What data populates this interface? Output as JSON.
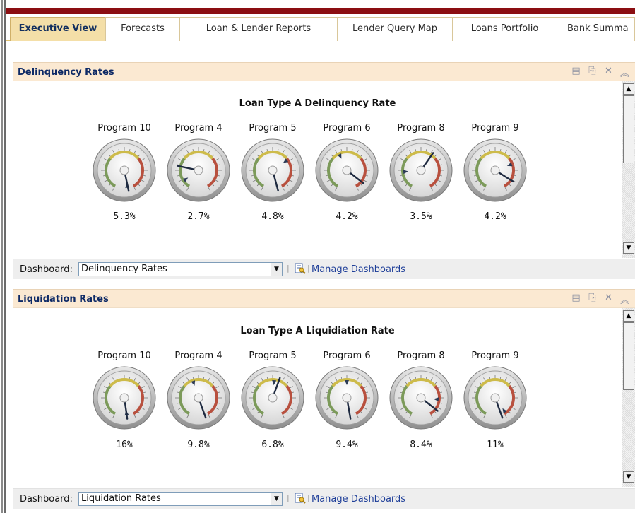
{
  "tabs": [
    {
      "label": "Executive View",
      "active": true
    },
    {
      "label": "Forecasts",
      "active": false
    },
    {
      "label": "Loan & Lender Reports",
      "active": false
    },
    {
      "label": "Lender Query Map",
      "active": false
    },
    {
      "label": "Loans Portfolio",
      "active": false
    },
    {
      "label": "Bank Summa",
      "active": false
    }
  ],
  "header_icons": [
    "document-icon",
    "export-icon",
    "close-icon",
    "collapse-icon"
  ],
  "panels": [
    {
      "title": "Delinquency Rates",
      "gauge_title": "Loan Type A Delinquency Rate",
      "gauges": [
        {
          "program": "Program 10",
          "value": "5.3%",
          "needle_deg": 168,
          "marker_deg": 170
        },
        {
          "program": "Program 4",
          "value": "2.7%",
          "needle_deg": -78,
          "marker_deg": -125
        },
        {
          "program": "Program 5",
          "value": "4.8%",
          "needle_deg": 165,
          "marker_deg": 55
        },
        {
          "program": "Program 6",
          "value": "4.2%",
          "needle_deg": 128,
          "marker_deg": -25
        },
        {
          "program": "Program 8",
          "value": "3.5%",
          "needle_deg": 35,
          "marker_deg": -95
        },
        {
          "program": "Program 9",
          "value": "4.2%",
          "needle_deg": 122,
          "marker_deg": 70
        }
      ],
      "footer_label": "Dashboard:",
      "dashboard_value": "Delinquency Rates",
      "manage_label": "Manage Dashboards"
    },
    {
      "title": "Liquidation Rates",
      "gauge_title": "Loan Type A Liquidiation Rate",
      "gauges": [
        {
          "program": "Program 10",
          "value": "16%",
          "needle_deg": 172,
          "marker_deg": 172
        },
        {
          "program": "Program 4",
          "value": "9.8%",
          "needle_deg": 160,
          "marker_deg": -18
        },
        {
          "program": "Program 5",
          "value": "6.8%",
          "needle_deg": 20,
          "marker_deg": 5
        },
        {
          "program": "Program 6",
          "value": "9.4%",
          "needle_deg": 170,
          "marker_deg": 0
        },
        {
          "program": "Program 8",
          "value": "8.4%",
          "needle_deg": 128,
          "marker_deg": 95
        },
        {
          "program": "Program 9",
          "value": "11%",
          "needle_deg": 160,
          "marker_deg": 145
        }
      ],
      "footer_label": "Dashboard:",
      "dashboard_value": "Liquidation Rates",
      "manage_label": "Manage Dashboards"
    }
  ],
  "colors": {
    "top_bar": "#8b0e12",
    "active_tab": "#f4dfa8",
    "panel_header": "#fbe9d2",
    "title_text": "#0e2a66",
    "link": "#1f3f99",
    "gauge_green": "#7c9a5a",
    "gauge_yellow": "#cdbb4a",
    "gauge_red": "#b8503e"
  }
}
